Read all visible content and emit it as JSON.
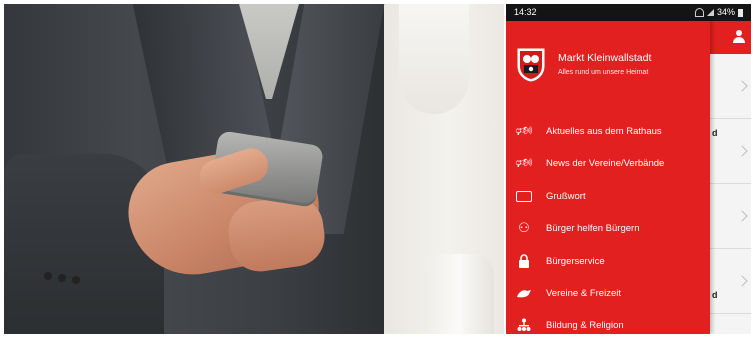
{
  "status_bar": {
    "time": "14:32",
    "battery": "34%"
  },
  "drawer": {
    "app_title": "Markt Kleinwallstadt",
    "app_subtitle": "Alles rund um unsere Heimat",
    "items": [
      {
        "label": "Aktuelles aus dem Rathaus",
        "icon": "megaphone-icon"
      },
      {
        "label": "News der Vereine/Verbände",
        "icon": "megaphone-icon"
      },
      {
        "label": "Grußwort",
        "icon": "id-card-icon"
      },
      {
        "label": "Bürger helfen Bürgern",
        "icon": "people-icon"
      },
      {
        "label": "Bürgerservice",
        "icon": "lock-icon"
      },
      {
        "label": "Vereine & Freizeit",
        "icon": "sport-icon"
      },
      {
        "label": "Bildung & Religion",
        "icon": "hierarchy-icon"
      }
    ]
  },
  "background_list": {
    "visible_fragment_1": "d",
    "visible_fragment_2": "d"
  },
  "colors": {
    "brand_red": "#e2201f",
    "status_bar": "#141414"
  }
}
